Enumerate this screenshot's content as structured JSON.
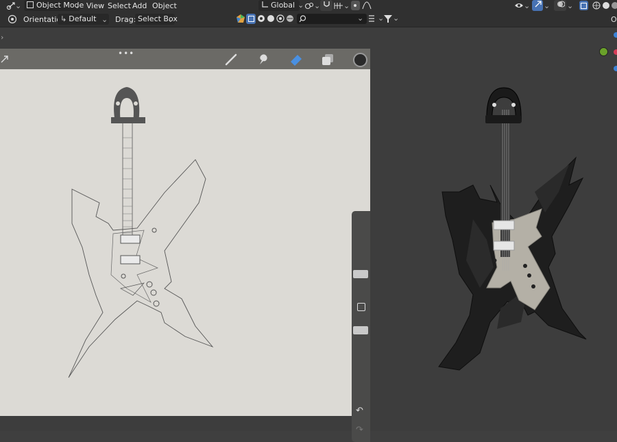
{
  "header": {
    "mode_label": "Object Mode",
    "menu": [
      "View",
      "Select",
      "Add",
      "Object"
    ],
    "transform_orientation": "Global"
  },
  "tool_settings": {
    "orientation_label": "Orientation:",
    "orientation_value": "Default",
    "drag_label": "Drag:",
    "drag_value": "Select Box",
    "right_cut_label": "Op"
  },
  "procreate": {
    "tools": [
      "brush-icon",
      "smudge-icon",
      "eraser-icon",
      "layers-icon",
      "color-icon"
    ]
  },
  "colors": {
    "header_bg": "#303030",
    "viewport_bg": "#3d3d3d",
    "canvas_bg": "#dcdad5",
    "accent_blue": "#4772b3"
  }
}
